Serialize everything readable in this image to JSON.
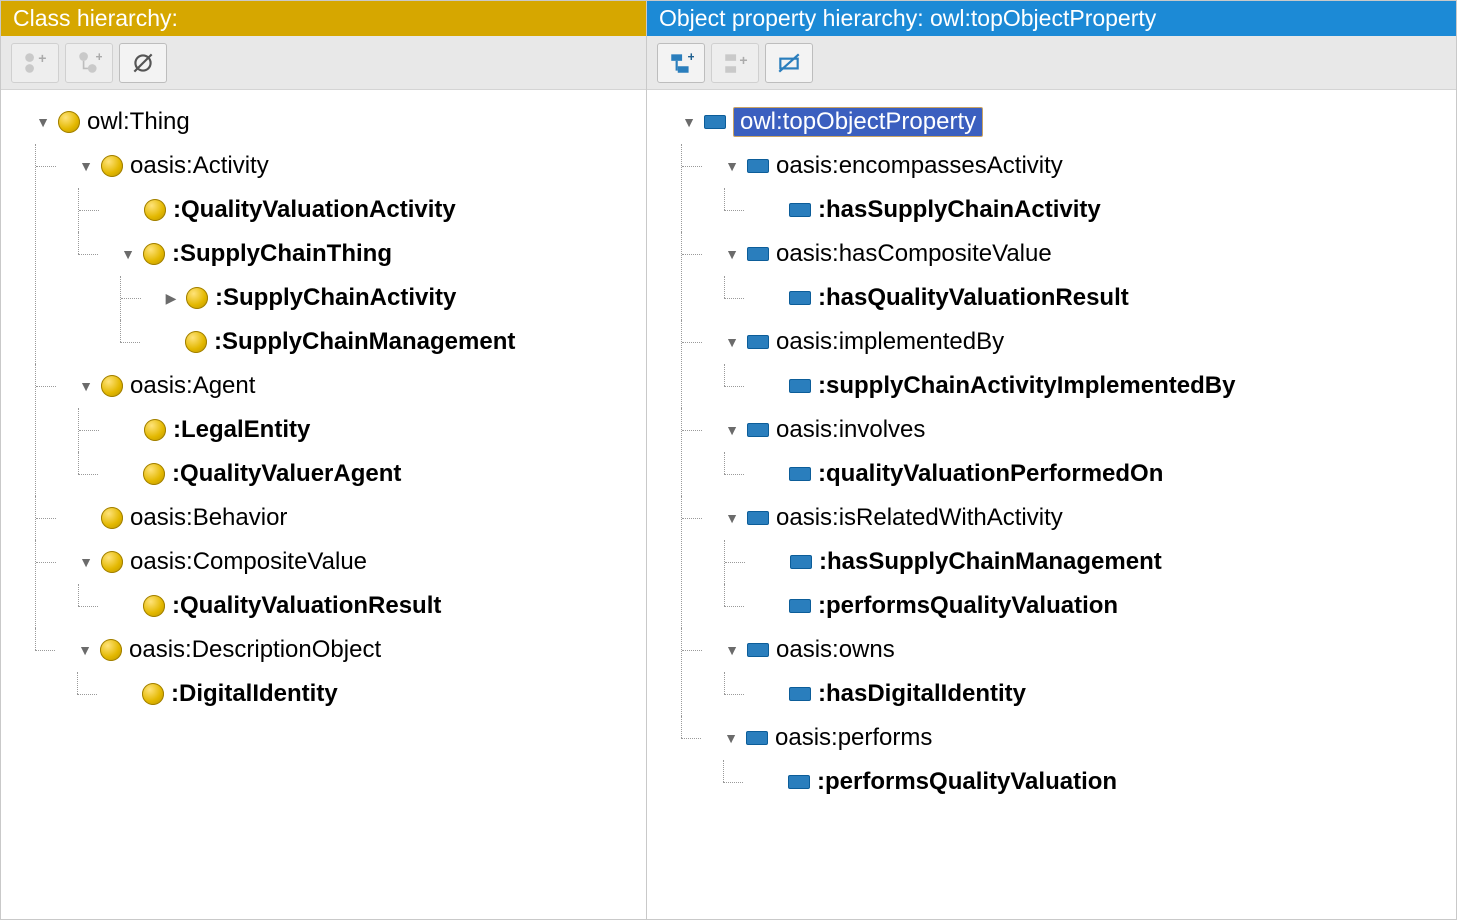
{
  "left_panel": {
    "title": "Class hierarchy:",
    "toolbar": {
      "add_sibling": "add-sibling",
      "add_child": "add-child",
      "delete": "delete"
    },
    "accent": "#d6a700",
    "tree": [
      {
        "label": "owl:Thing",
        "bold": false,
        "expanded": true,
        "children": [
          {
            "label": "oasis:Activity",
            "bold": false,
            "expanded": true,
            "children": [
              {
                "label": ":QualityValuationActivity",
                "bold": true,
                "leaf": true
              },
              {
                "label": ":SupplyChainThing",
                "bold": true,
                "expanded": true,
                "children": [
                  {
                    "label": ":SupplyChainActivity",
                    "bold": true,
                    "collapsed": true
                  },
                  {
                    "label": ":SupplyChainManagement",
                    "bold": true,
                    "leaf": true
                  }
                ]
              }
            ]
          },
          {
            "label": "oasis:Agent",
            "bold": false,
            "expanded": true,
            "children": [
              {
                "label": ":LegalEntity",
                "bold": true,
                "leaf": true
              },
              {
                "label": ":QualityValuerAgent",
                "bold": true,
                "leaf": true
              }
            ]
          },
          {
            "label": "oasis:Behavior",
            "bold": false,
            "leaf": true
          },
          {
            "label": "oasis:CompositeValue",
            "bold": false,
            "expanded": true,
            "children": [
              {
                "label": ":QualityValuationResult",
                "bold": true,
                "leaf": true
              }
            ]
          },
          {
            "label": "oasis:DescriptionObject",
            "bold": false,
            "expanded": true,
            "children": [
              {
                "label": ":DigitalIdentity",
                "bold": true,
                "leaf": true
              }
            ]
          }
        ]
      }
    ]
  },
  "right_panel": {
    "title": "Object property hierarchy: owl:topObjectProperty",
    "toolbar": {
      "add_sub": "add-subproperty",
      "add_sibling": "add-sibling",
      "delete": "delete"
    },
    "accent": "#1c8ad6",
    "selected": "owl:topObjectProperty",
    "tree": [
      {
        "label": "owl:topObjectProperty",
        "bold": false,
        "selected": true,
        "expanded": true,
        "children": [
          {
            "label": "oasis:encompassesActivity",
            "bold": false,
            "expanded": true,
            "children": [
              {
                "label": ":hasSupplyChainActivity",
                "bold": true,
                "leaf": true
              }
            ]
          },
          {
            "label": "oasis:hasCompositeValue",
            "bold": false,
            "expanded": true,
            "children": [
              {
                "label": ":hasQualityValuationResult",
                "bold": true,
                "leaf": true
              }
            ]
          },
          {
            "label": "oasis:implementedBy",
            "bold": false,
            "expanded": true,
            "children": [
              {
                "label": ":supplyChainActivityImplementedBy",
                "bold": true,
                "leaf": true
              }
            ]
          },
          {
            "label": "oasis:involves",
            "bold": false,
            "expanded": true,
            "children": [
              {
                "label": ":qualityValuationPerformedOn",
                "bold": true,
                "leaf": true
              }
            ]
          },
          {
            "label": "oasis:isRelatedWithActivity",
            "bold": false,
            "expanded": true,
            "children": [
              {
                "label": ":hasSupplyChainManagement",
                "bold": true,
                "leaf": true
              },
              {
                "label": ":performsQualityValuation",
                "bold": true,
                "leaf": true
              }
            ]
          },
          {
            "label": "oasis:owns",
            "bold": false,
            "expanded": true,
            "children": [
              {
                "label": ":hasDigitalIdentity",
                "bold": true,
                "leaf": true
              }
            ]
          },
          {
            "label": "oasis:performs",
            "bold": false,
            "expanded": true,
            "children": [
              {
                "label": ":performsQualityValuation",
                "bold": true,
                "leaf": true
              }
            ]
          }
        ]
      }
    ]
  }
}
